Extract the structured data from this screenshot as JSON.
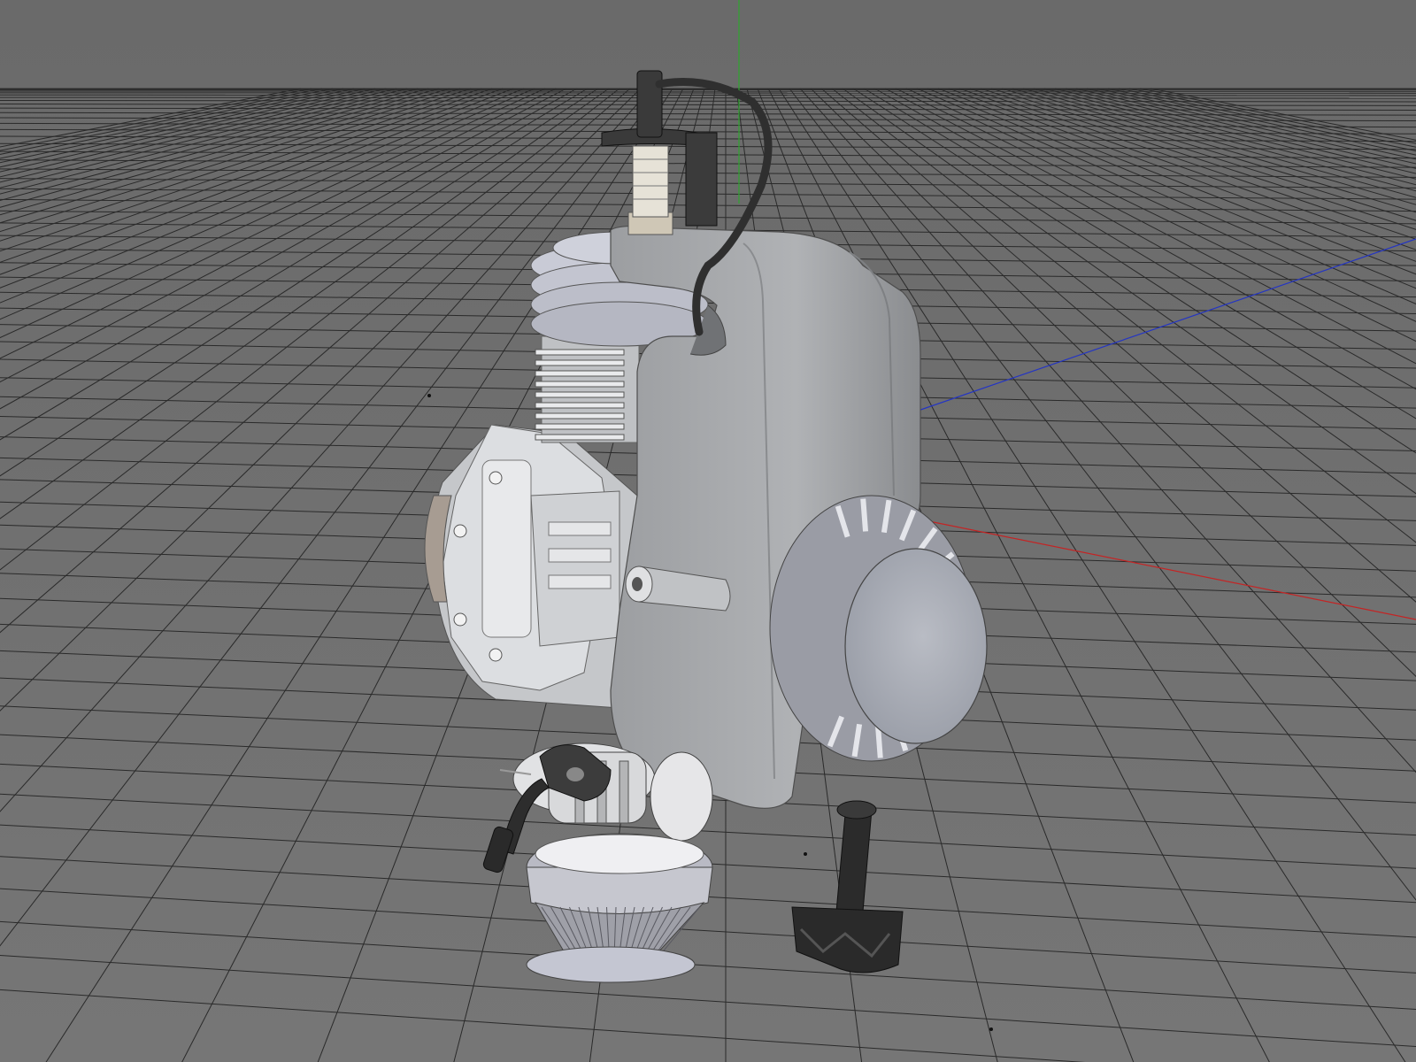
{
  "viewport": {
    "background": "#6e6e6e",
    "grid_color": "#2a2a2a",
    "axes": {
      "x_color": "#c02020",
      "y_color": "#20a020",
      "z_color": "#2030c0"
    }
  },
  "model": {
    "body_color": "#a6a8ab",
    "light_color": "#d6d8dc",
    "dark_color": "#2e2e2e",
    "parts": [
      "spark-plug",
      "ignition-lead",
      "cylinder-fins",
      "shroud",
      "pull-starter-cover",
      "crankcase",
      "carburetor",
      "air-filter",
      "clutch-arm"
    ]
  }
}
